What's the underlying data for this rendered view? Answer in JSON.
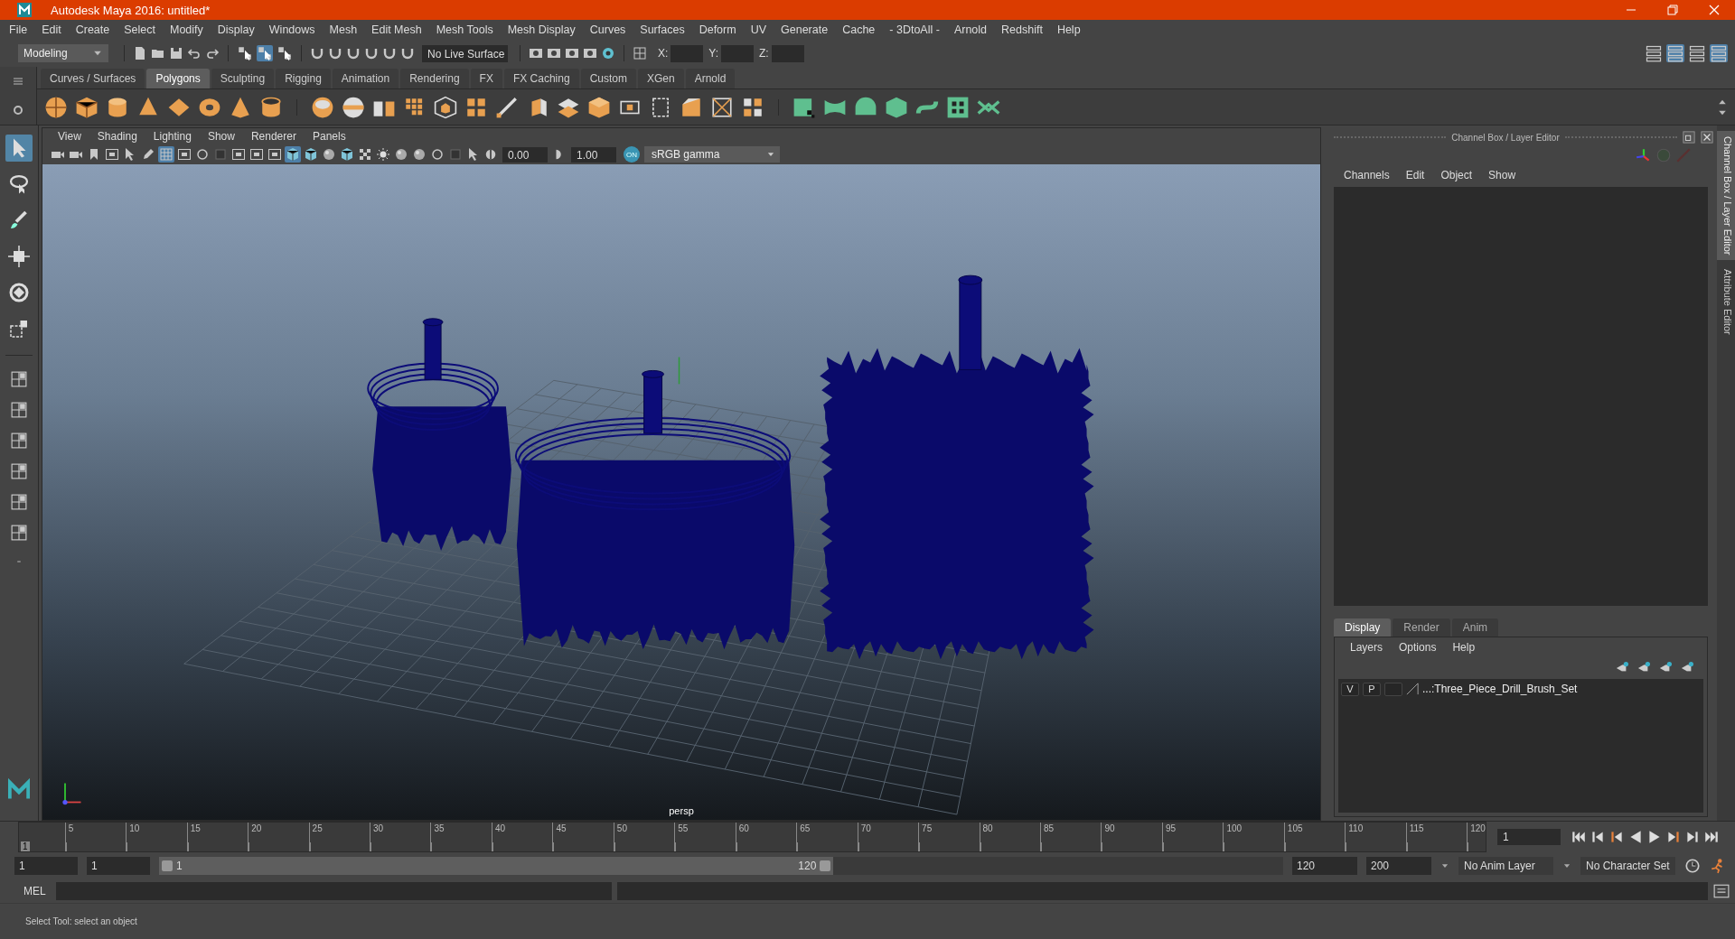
{
  "window": {
    "title": "Autodesk Maya 2016: untitled*"
  },
  "menu_bar": [
    "File",
    "Edit",
    "Create",
    "Select",
    "Modify",
    "Display",
    "Windows",
    "Mesh",
    "Edit Mesh",
    "Mesh Tools",
    "Mesh Display",
    "Curves",
    "Surfaces",
    "Deform",
    "UV",
    "Generate",
    "Cache",
    "- 3DtoAll -",
    "Arnold",
    "Redshift",
    "Help"
  ],
  "status_line": {
    "mode": "Modeling",
    "selection_masks": [
      {
        "selected": false
      },
      {
        "selected": true
      },
      {
        "selected": false
      }
    ],
    "live_surface": "No Live Surface",
    "coord_labels": [
      "X:",
      "Y:",
      "Z:"
    ],
    "panel_toggles": [
      {
        "selected": false
      },
      {
        "selected": true
      },
      {
        "selected": false
      },
      {
        "selected": true
      }
    ]
  },
  "shelf_tabs": [
    {
      "label": "Curves / Surfaces",
      "selected": false
    },
    {
      "label": "Polygons",
      "selected": true
    },
    {
      "label": "Sculpting",
      "selected": false
    },
    {
      "label": "Rigging",
      "selected": false
    },
    {
      "label": "Animation",
      "selected": false
    },
    {
      "label": "Rendering",
      "selected": false
    },
    {
      "label": "FX",
      "selected": false
    },
    {
      "label": "FX Caching",
      "selected": false
    },
    {
      "label": "Custom",
      "selected": false
    },
    {
      "label": "XGen",
      "selected": false
    },
    {
      "label": "Arnold",
      "selected": false
    }
  ],
  "toolbox": {
    "tools": [
      {
        "selected": true
      },
      {
        "selected": false
      },
      {
        "selected": false
      },
      {
        "selected": false
      },
      {
        "selected": false
      },
      {
        "selected": false
      }
    ]
  },
  "viewport": {
    "menus": [
      "View",
      "Shading",
      "Lighting",
      "Show",
      "Renderer",
      "Panels"
    ],
    "toolbar": [
      {
        "selected": false
      },
      {
        "selected": false
      },
      {
        "selected": false
      },
      {
        "selected": false
      },
      {
        "selected": false
      },
      {
        "selected": false
      },
      {
        "selected": true
      },
      {
        "selected": false
      },
      {
        "selected": false
      },
      {
        "selected": false
      },
      {
        "selected": false
      },
      {
        "selected": false
      },
      {
        "selected": false
      },
      {
        "selected": true
      },
      {
        "selected": false
      },
      {
        "selected": false
      },
      {
        "selected": false
      },
      {
        "selected": false
      },
      {
        "selected": false
      },
      {
        "selected": false
      },
      {
        "selected": false
      },
      {
        "selected": false
      },
      {
        "selected": false
      },
      {
        "selected": false
      }
    ],
    "exposure": "0.00",
    "gamma": "1.00",
    "color_management": "ON",
    "color_space": "sRGB gamma",
    "camera": "persp"
  },
  "channel_box": {
    "title": "Channel Box / Layer Editor",
    "menus": [
      "Channels",
      "Edit",
      "Object",
      "Show"
    ]
  },
  "layer_editor": {
    "tabs": [
      {
        "label": "Display",
        "selected": true
      },
      {
        "label": "Render",
        "selected": false
      },
      {
        "label": "Anim",
        "selected": false
      }
    ],
    "menus": [
      "Layers",
      "Options",
      "Help"
    ],
    "layers": [
      {
        "visibility": "V",
        "playback": "P",
        "name": "...:Three_Piece_Drill_Brush_Set"
      }
    ]
  },
  "side_tabs": [
    "Channel Box / Layer Editor",
    "Attribute Editor"
  ],
  "time_slider": {
    "current_frame": "1",
    "level": 0,
    "ticks": [
      "5",
      "10",
      "15",
      "20",
      "25",
      "30",
      "35",
      "40",
      "45",
      "50",
      "55",
      "60",
      "65",
      "70",
      "75",
      "80",
      "85",
      "90",
      "95",
      "100",
      "105",
      "110",
      "115",
      "120"
    ],
    "frame_field": "1"
  },
  "range_slider": {
    "level": 0.6,
    "start": "1",
    "playback_start": "1",
    "range_start": "1",
    "range_end": "120",
    "playback_end": "120",
    "end": "200",
    "anim_layer": "No Anim Layer",
    "character_set": "No Character Set"
  },
  "command_line": {
    "label": "MEL"
  },
  "help_line": "Select Tool: select an object"
}
